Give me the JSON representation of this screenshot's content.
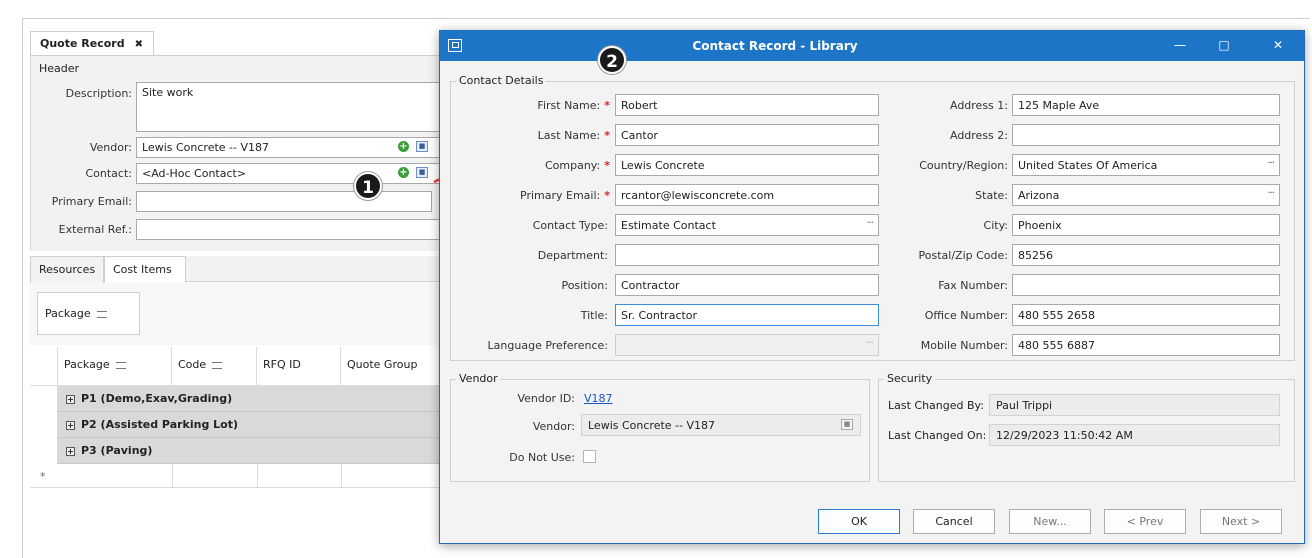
{
  "quote_record": {
    "tab_title": "Quote Record",
    "header_label": "Header",
    "description_label": "Description:",
    "description_value": "Site work",
    "vendor_label": "Vendor:",
    "vendor_value": "Lewis Concrete -- V187",
    "contact_label": "Contact:",
    "contact_value": "<Ad-Hoc Contact>",
    "primary_email_label": "Primary Email:",
    "external_ref_label": "External Ref.:",
    "tabs": [
      "Resources",
      "Cost Items"
    ],
    "package_group_label": "Package",
    "grid_columns": [
      "Package",
      "Code",
      "RFQ ID",
      "Quote Group"
    ],
    "grid_rows": [
      "P1 (Demo,Exav,Grading)",
      "P2 (Assisted Parking Lot)",
      "P3 (Paving)"
    ],
    "new_row_marker": "*"
  },
  "callouts": [
    "1",
    "2"
  ],
  "dialog": {
    "title": "Contact Record - Library",
    "contact_details_legend": "Contact Details",
    "left_fields": [
      {
        "label": "First Name:",
        "value": "Robert",
        "required": true
      },
      {
        "label": "Last Name:",
        "value": "Cantor",
        "required": true
      },
      {
        "label": "Company:",
        "value": "Lewis Concrete",
        "required": true
      },
      {
        "label": "Primary Email:",
        "value": "rcantor@lewisconcrete.com",
        "required": true
      },
      {
        "label": "Contact Type:",
        "value": "Estimate Contact",
        "required": false
      },
      {
        "label": "Department:",
        "value": "",
        "required": false
      },
      {
        "label": "Position:",
        "value": "Contractor",
        "required": false
      },
      {
        "label": "Title:",
        "value": "Sr. Contractor",
        "required": false
      },
      {
        "label": "Language Preference:",
        "value": "",
        "required": false
      }
    ],
    "right_fields": [
      {
        "label": "Address 1:",
        "value": "125 Maple Ave"
      },
      {
        "label": "Address 2:",
        "value": ""
      },
      {
        "label": "Country/Region:",
        "value": "United States Of America"
      },
      {
        "label": "State:",
        "value": "Arizona"
      },
      {
        "label": "City:",
        "value": "Phoenix"
      },
      {
        "label": "Postal/Zip Code:",
        "value": "85256"
      },
      {
        "label": "Fax Number:",
        "value": ""
      },
      {
        "label": "Office Number:",
        "value": "480 555 2658"
      },
      {
        "label": "Mobile Number:",
        "value": "480 555 6887"
      }
    ],
    "vendor_legend": "Vendor",
    "vendor_id_label": "Vendor ID:",
    "vendor_id_value": "V187",
    "vendor_label": "Vendor:",
    "vendor_value": "Lewis Concrete -- V187",
    "do_not_use_label": "Do Not Use:",
    "security_legend": "Security",
    "last_changed_by_label": "Last Changed By:",
    "last_changed_by_value": "Paul Trippi",
    "last_changed_on_label": "Last Changed On:",
    "last_changed_on_value": "12/29/2023 11:50:42 AM",
    "buttons": {
      "ok": "OK",
      "cancel": "Cancel",
      "new": "New...",
      "prev": "< Prev",
      "next": "Next >"
    }
  },
  "colors": {
    "title_bar": "#1c75c6",
    "required_star": "#d22222",
    "link": "#1a55c8"
  }
}
